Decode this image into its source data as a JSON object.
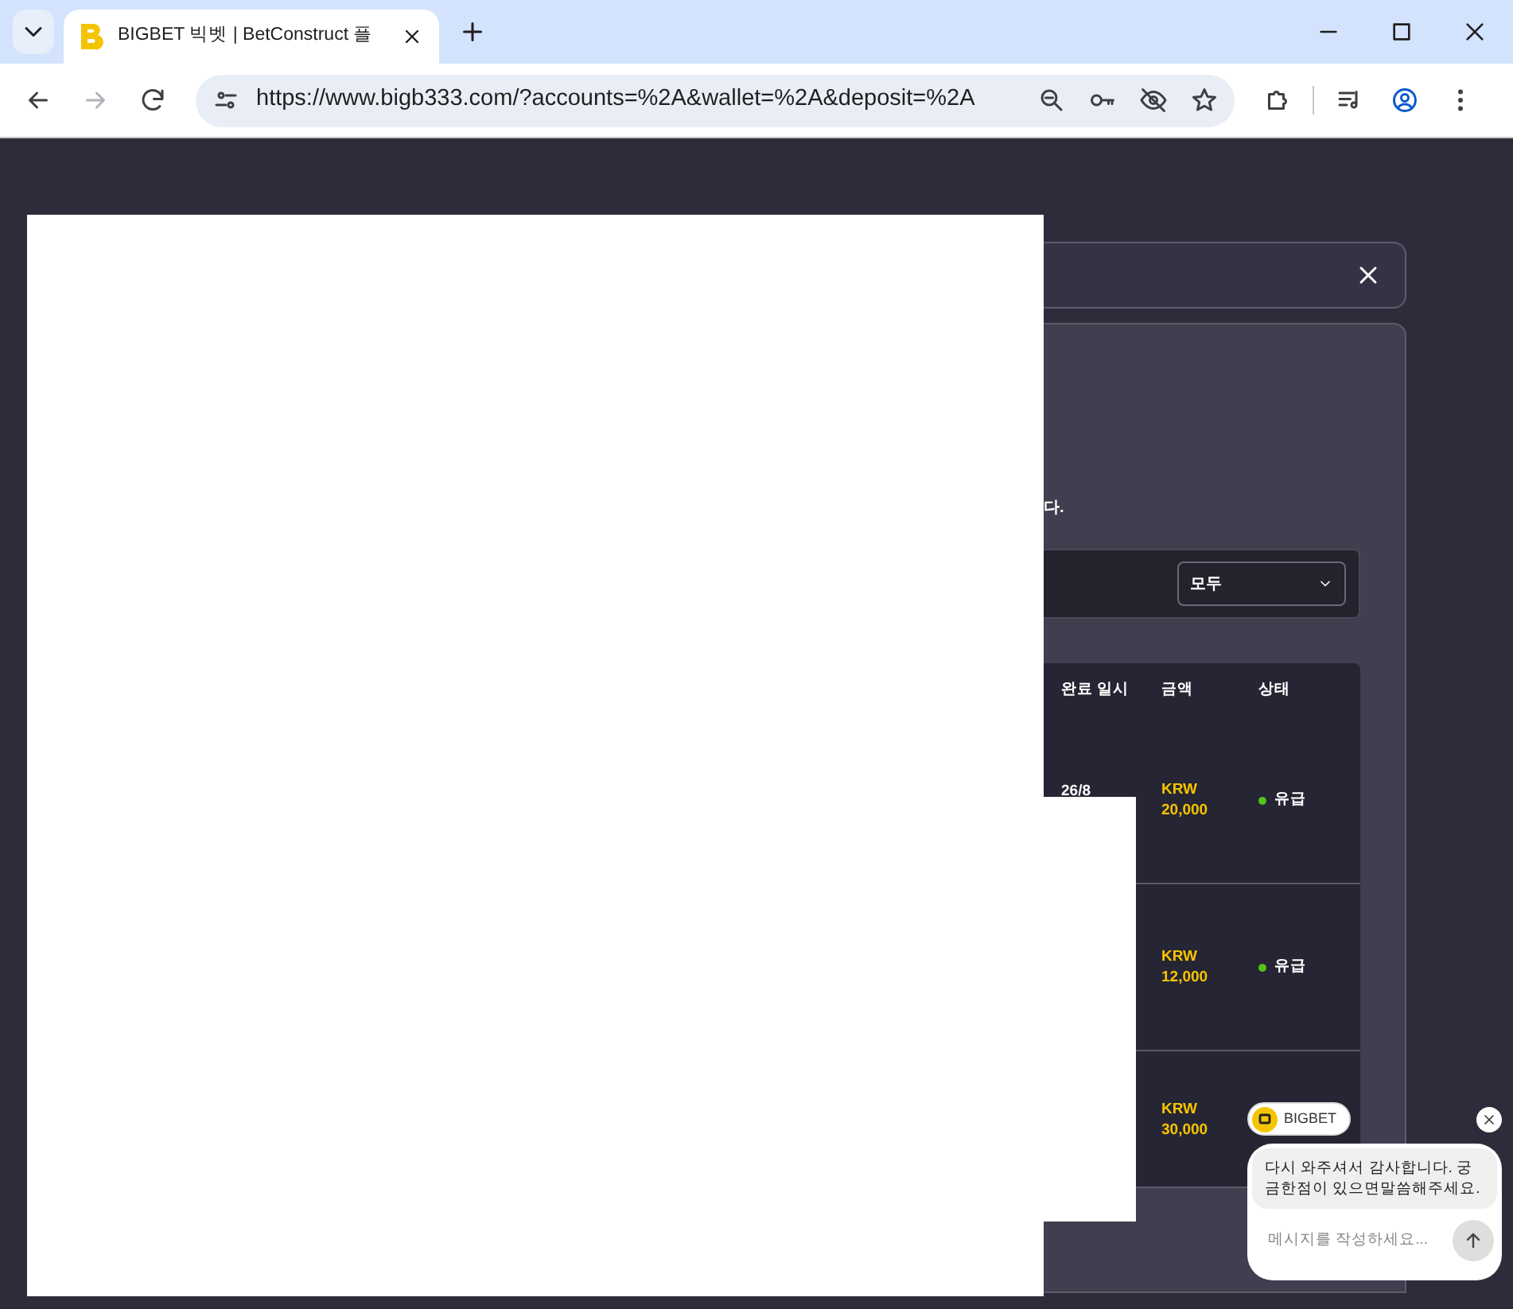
{
  "browser": {
    "tab_title": "BIGBET 빅벳 | BetConstruct 플",
    "url": "https://www.bigb333.com/?accounts=%2A&wallet=%2A&deposit=%2A",
    "forward_disabled": true
  },
  "notice": "다.",
  "filter": {
    "value": "모두"
  },
  "table": {
    "columns": [
      "완료 일시",
      "금액",
      "상태"
    ],
    "rows": [
      {
        "date": "26/8",
        "amount": [
          "KRW",
          "20,000"
        ],
        "status": "유급"
      },
      {
        "amount": [
          "KRW",
          "12,000"
        ],
        "status": "유급"
      },
      {
        "amount": [
          "KRW",
          "30,000"
        ]
      }
    ]
  },
  "chat": {
    "brand": "BIGBET",
    "message": "다시 와주셔서 감사합니다. 궁금한점이 있으면말씀해주세요.",
    "placeholder": "메시지를 작성하세요..."
  }
}
